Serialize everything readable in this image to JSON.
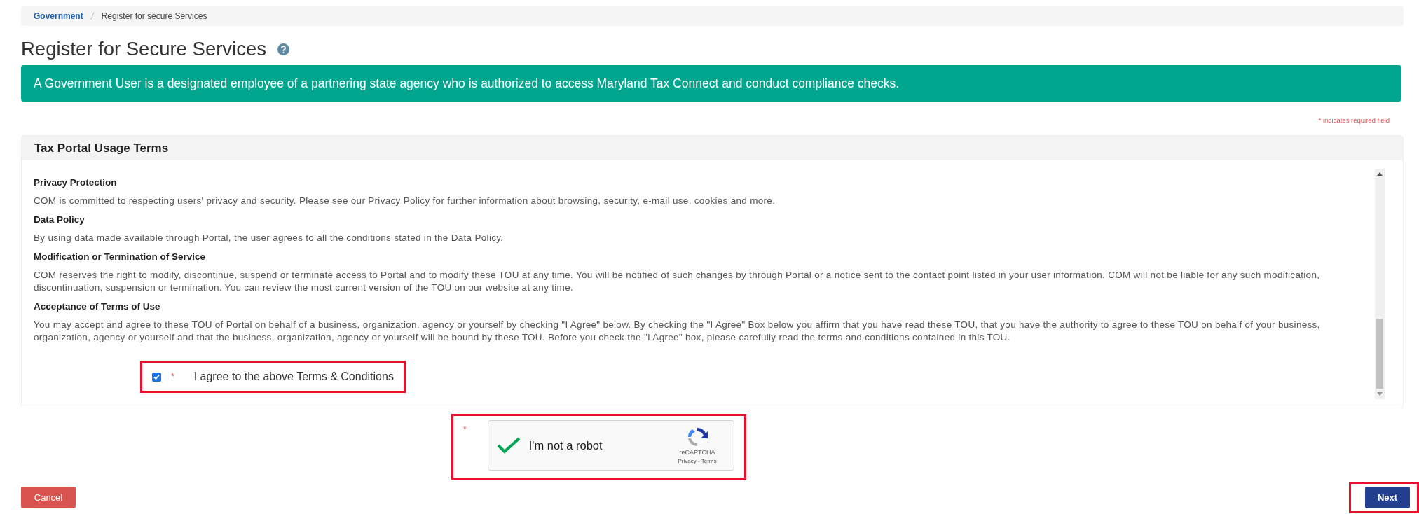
{
  "breadcrumb": [
    {
      "label": "Government",
      "kind": "link"
    },
    {
      "label": "Register for secure Services",
      "kind": "current"
    }
  ],
  "page_title": "Register for Secure Services",
  "info_banner": "A Government User is a designated employee of a partnering state agency who is authorized to access Maryland Tax Connect and conduct compliance checks.",
  "required_note": "* indicates required field",
  "terms_panel": {
    "title": "Tax Portal Usage Terms",
    "sections": [
      {
        "heading": "Privacy Protection",
        "text": "COM is committed to respecting users' privacy and security. Please see our Privacy Policy for further information about browsing, security, e-mail use, cookies and more."
      },
      {
        "heading": "Data Policy",
        "text": "By using data made available through Portal, the user agrees to all the conditions stated in the Data Policy."
      },
      {
        "heading": "Modification or Termination of Service",
        "text": "COM reserves the right to modify, discontinue, suspend or terminate access to Portal and to modify these TOU at any time. You will be notified of such changes by through Portal or a notice sent to the contact point listed in your user information. COM will not be liable for any such modification, discontinuation, suspension or termination. You can review the most current version of the TOU on our website at any time."
      },
      {
        "heading": "Acceptance of Terms of Use",
        "text": "You may accept and agree to these TOU of Portal on behalf of a business, organization, agency or yourself by checking \"I Agree\" below. By checking the \"I Agree\" Box below you affirm that you have read these TOU, that you have the authority to agree to these TOU on behalf of your business, organization, agency or yourself and that the business, organization, agency or yourself will be bound by these TOU. Before you check the \"I Agree\" box, please carefully read the terms and conditions contained in this TOU."
      }
    ],
    "agree": {
      "label": "I agree to the above Terms & Conditions",
      "required_mark": "*",
      "checked": true,
      "highlighted": true
    }
  },
  "captcha": {
    "required_mark": "*",
    "label": "I'm not a robot",
    "brand": "reCAPTCHA",
    "links": "Privacy - Terms",
    "checked": true,
    "highlighted": true
  },
  "buttons": [
    {
      "label": "Cancel",
      "kind": "cancel",
      "highlighted": false
    },
    {
      "label": "Next",
      "kind": "next",
      "highlighted": true
    }
  ]
}
